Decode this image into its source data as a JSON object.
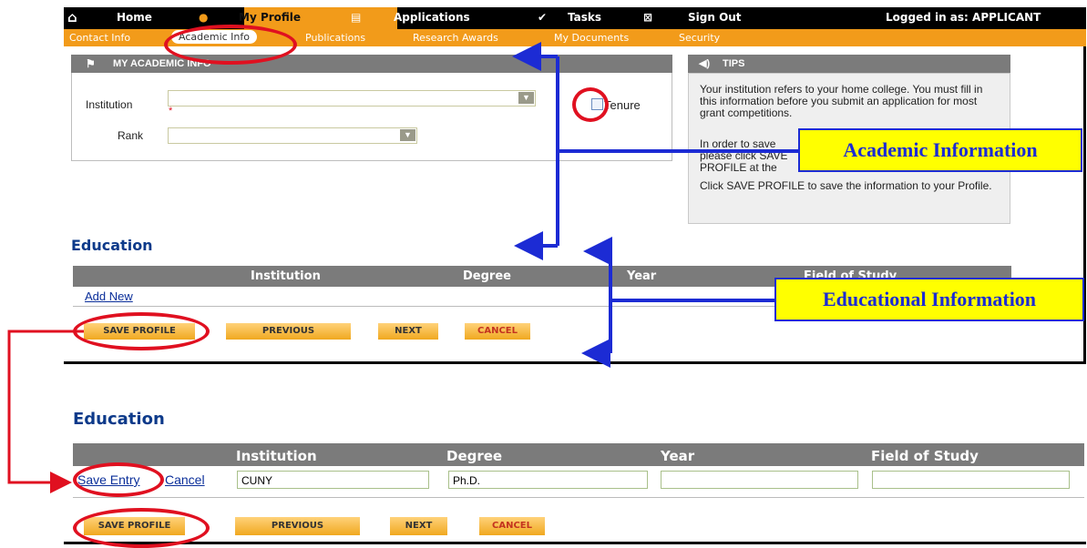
{
  "topnav": {
    "home": "Home",
    "profile": "My Profile",
    "applications": "Applications",
    "tasks": "Tasks",
    "signout": "Sign Out",
    "logged_in": "Logged in as: APPLICANT"
  },
  "subnav": [
    "Contact Info",
    "Academic Info",
    "Publications",
    "Research Awards",
    "My Documents",
    "Security"
  ],
  "academic": {
    "header": "MY ACADEMIC INFO",
    "institution_label": "Institution",
    "rank_label": "Rank",
    "required_mark": "*",
    "tenure_label": "Tenure"
  },
  "tips": {
    "header": "TIPS",
    "p1": "Your institution refers to your home college. You must fill in this information before you submit an application for most grant competitions.",
    "p2": "In order to save please click SAVE PROFILE at the bottom of the fields",
    "p3": "Click SAVE PROFILE to save the information to your Profile."
  },
  "education": {
    "title": "Education",
    "columns": [
      "Institution",
      "Degree",
      "Year",
      "Field of Study"
    ],
    "add_new": "Add New",
    "save_entry": "Save Entry",
    "cancel_link": "Cancel",
    "entry": {
      "institution": "CUNY",
      "degree": "Ph.D.",
      "year": "",
      "field": ""
    }
  },
  "buttons": {
    "save_profile": "SAVE PROFILE",
    "previous": "PREVIOUS",
    "next": "NEXT",
    "cancel": "CANCEL"
  },
  "callouts": {
    "academic": "Academic Information",
    "educational": "Educational Information"
  },
  "colors": {
    "accent_orange": "#f29b1a",
    "annotation_red": "#e01020",
    "annotation_blue": "#1c2bd4",
    "callout_yellow": "#ffff00"
  }
}
